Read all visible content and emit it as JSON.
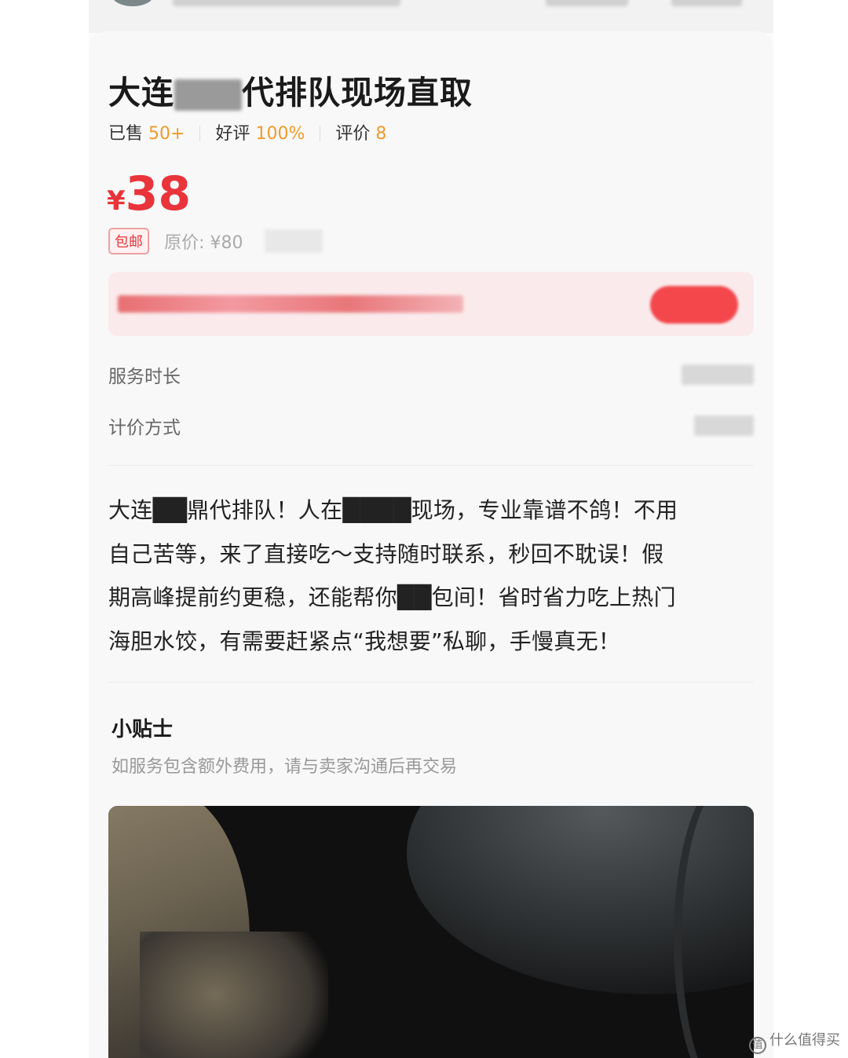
{
  "product": {
    "title_prefix": "大连",
    "title_suffix": "代排队现场直取",
    "sold_label": "已售",
    "sold_value": "50+",
    "rating_label": "好评",
    "rating_value": "100%",
    "review_label": "评价",
    "review_value": "8",
    "price_currency": "¥",
    "price_value": "38",
    "shipping_badge": "包邮",
    "original_price": "原价: ¥80"
  },
  "attributes": [
    {
      "label": "服务时长"
    },
    {
      "label": "计价方式"
    }
  ],
  "description": {
    "line1": "大连██鼎代排队！人在████现场，专业靠谱不鸽！不用",
    "line2": "自己苦等，来了直接吃～支持随时联系，秒回不耽误！假",
    "line3": "期高峰提前约更稳，还能帮你██包间！省时省力吃上热门",
    "line4": "海胆水饺，有需要赶紧点“我想要”私聊，手慢真无！"
  },
  "tips": {
    "title": "小贴士",
    "text": "如服务包含额外费用，请与卖家沟通后再交易"
  },
  "watermark": {
    "icon_glyph": "值",
    "text": "什么值得买"
  }
}
